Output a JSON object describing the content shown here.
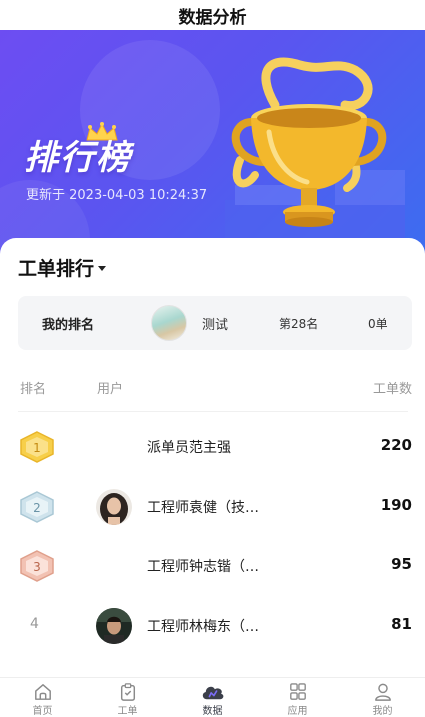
{
  "header": {
    "title": "数据分析"
  },
  "banner": {
    "title": "排行榜",
    "updated": "更新于 2023-04-03 10:24:37"
  },
  "section": {
    "title": "工单排行"
  },
  "my_rank": {
    "label": "我的排名",
    "name": "测试",
    "rank": "第28名",
    "count": "0单"
  },
  "columns": {
    "rank": "排名",
    "user": "用户",
    "count": "工单数"
  },
  "rows": [
    {
      "rank": "1",
      "name": "派单员范主强",
      "score": "220"
    },
    {
      "rank": "2",
      "name": "工程师袁健（技…",
      "score": "190"
    },
    {
      "rank": "3",
      "name": "工程师钟志锴（…",
      "score": "95"
    },
    {
      "rank": "4",
      "name": "工程师林梅东（…",
      "score": "81"
    }
  ],
  "tabs": [
    {
      "label": "首页",
      "icon": "home-icon"
    },
    {
      "label": "工单",
      "icon": "clipboard-icon"
    },
    {
      "label": "数据",
      "icon": "cloud-data-icon"
    },
    {
      "label": "应用",
      "icon": "grid-apps-icon"
    },
    {
      "label": "我的",
      "icon": "user-icon"
    }
  ],
  "colors": {
    "accent": "#5a55f0",
    "gold": "#f3c23f",
    "silver": "#cfe3ec",
    "bronze": "#f2c2b3"
  }
}
